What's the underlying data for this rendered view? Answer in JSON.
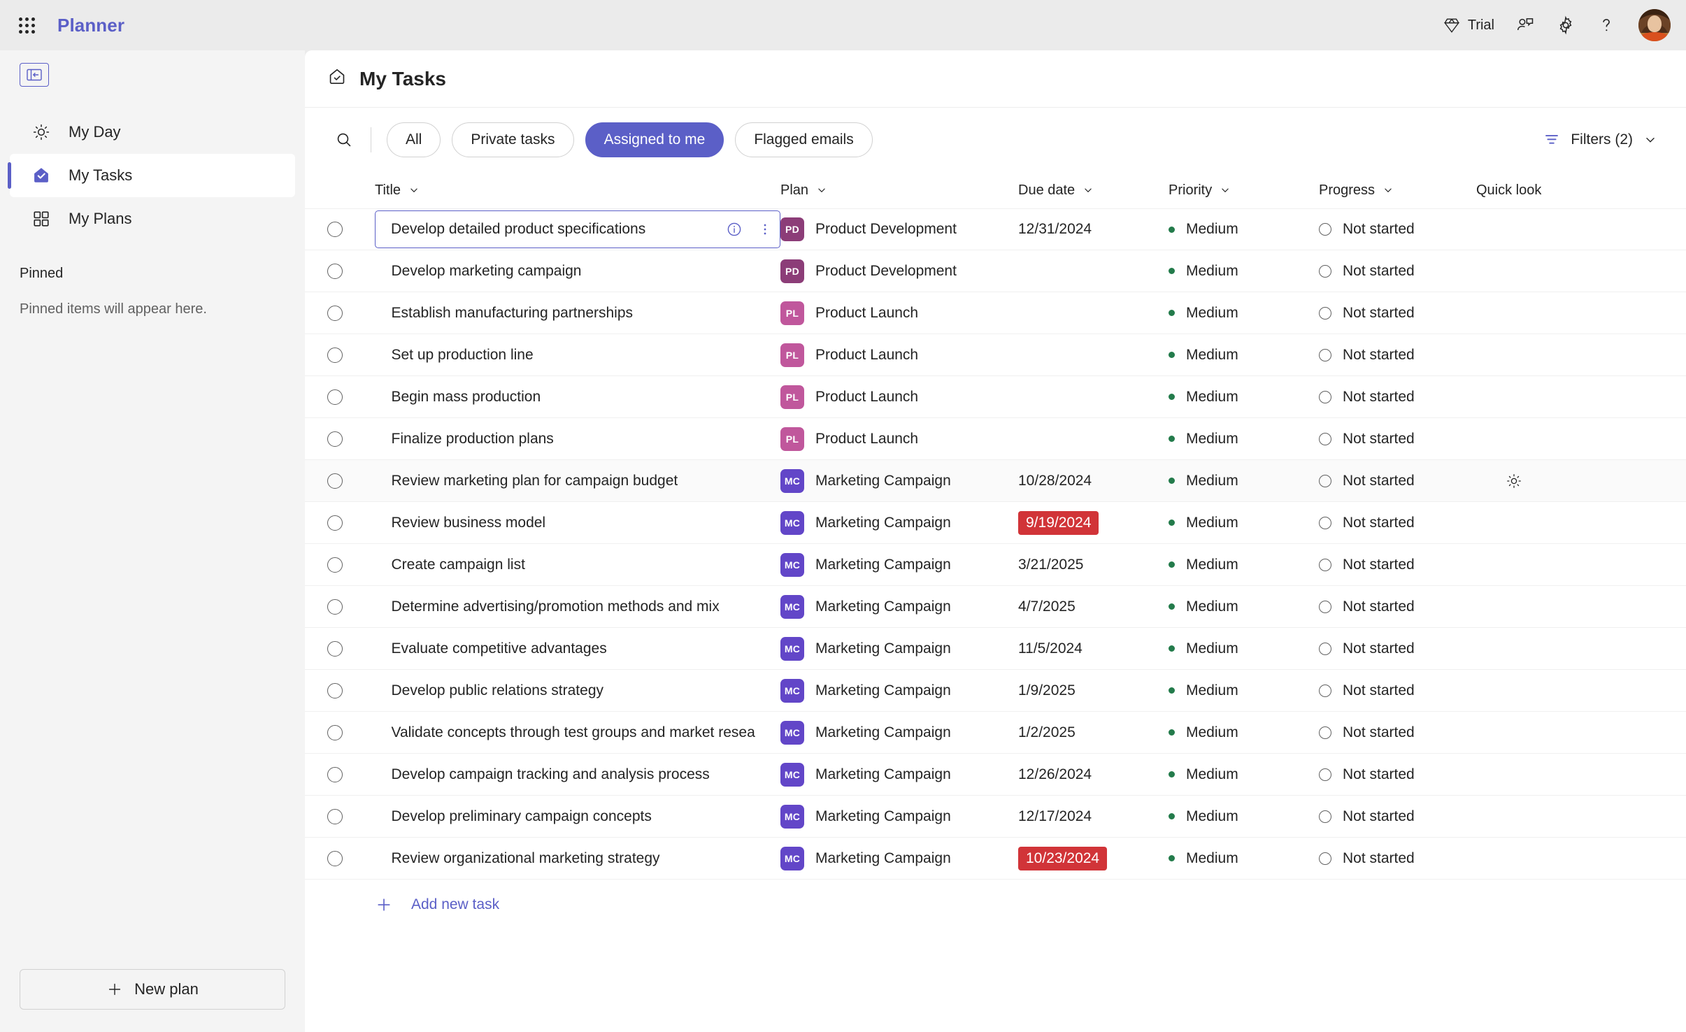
{
  "topbar": {
    "waffle_label": "app-launcher",
    "brand": "Planner",
    "trial_label": "Trial",
    "feedback_label": "feedback",
    "settings_label": "settings",
    "help_label": "help"
  },
  "sidebar": {
    "collapse_label": "collapse-navigation",
    "items": [
      {
        "label": "My Day",
        "icon": "sun-icon",
        "active": false
      },
      {
        "label": "My Tasks",
        "icon": "tasks-envelope-icon",
        "active": true
      },
      {
        "label": "My Plans",
        "icon": "grid-icon",
        "active": false
      }
    ],
    "pinned_header": "Pinned",
    "pinned_empty": "Pinned items will appear here.",
    "new_plan_label": "New plan"
  },
  "main": {
    "page_title": "My Tasks",
    "page_icon": "tasks-envelope-outline-icon",
    "search_placeholder": "Search",
    "pills": [
      {
        "label": "All",
        "selected": false
      },
      {
        "label": "Private tasks",
        "selected": false
      },
      {
        "label": "Assigned to me",
        "selected": true
      },
      {
        "label": "Flagged emails",
        "selected": false
      }
    ],
    "filters_label": "Filters (2)",
    "columns": [
      {
        "label": "Title",
        "sortable": true
      },
      {
        "label": "Plan",
        "sortable": true
      },
      {
        "label": "Due date",
        "sortable": true
      },
      {
        "label": "Priority",
        "sortable": true
      },
      {
        "label": "Progress",
        "sortable": true
      },
      {
        "label": "Quick look",
        "sortable": false
      }
    ],
    "add_new_task_label": "Add new task"
  },
  "colors": {
    "brand_purple": "#5b5fc7",
    "overdue_red": "#d13438",
    "priority_medium_green": "#237b4b",
    "plan_pd": "#8c3d78",
    "plan_pl": "#c0579c",
    "plan_mc": "#6246c8"
  },
  "plans": {
    "PD": {
      "initials": "PD",
      "name": "Product Development",
      "color": "#8c3d78"
    },
    "PL": {
      "initials": "PL",
      "name": "Product Launch",
      "color": "#c0579c"
    },
    "MC": {
      "initials": "MC",
      "name": "Marketing Campaign",
      "color": "#6246c8"
    }
  },
  "tasks": [
    {
      "title": "Develop detailed product specifications",
      "plan": "PD",
      "due": "12/31/2024",
      "overdue": false,
      "priority": "Medium",
      "progress": "Not started",
      "focused": true,
      "hovered": false
    },
    {
      "title": "Develop marketing campaign",
      "plan": "PD",
      "due": "",
      "overdue": false,
      "priority": "Medium",
      "progress": "Not started",
      "focused": false,
      "hovered": false
    },
    {
      "title": "Establish manufacturing partnerships",
      "plan": "PL",
      "due": "",
      "overdue": false,
      "priority": "Medium",
      "progress": "Not started",
      "focused": false,
      "hovered": false
    },
    {
      "title": "Set up production line",
      "plan": "PL",
      "due": "",
      "overdue": false,
      "priority": "Medium",
      "progress": "Not started",
      "focused": false,
      "hovered": false
    },
    {
      "title": "Begin mass production",
      "plan": "PL",
      "due": "",
      "overdue": false,
      "priority": "Medium",
      "progress": "Not started",
      "focused": false,
      "hovered": false
    },
    {
      "title": "Finalize production plans",
      "plan": "PL",
      "due": "",
      "overdue": false,
      "priority": "Medium",
      "progress": "Not started",
      "focused": false,
      "hovered": false
    },
    {
      "title": "Review marketing plan for campaign budget",
      "plan": "MC",
      "due": "10/28/2024",
      "overdue": false,
      "priority": "Medium",
      "progress": "Not started",
      "focused": false,
      "hovered": true
    },
    {
      "title": "Review business model",
      "plan": "MC",
      "due": "9/19/2024",
      "overdue": true,
      "priority": "Medium",
      "progress": "Not started",
      "focused": false,
      "hovered": false
    },
    {
      "title": "Create campaign list",
      "plan": "MC",
      "due": "3/21/2025",
      "overdue": false,
      "priority": "Medium",
      "progress": "Not started",
      "focused": false,
      "hovered": false
    },
    {
      "title": "Determine advertising/promotion methods and mix",
      "plan": "MC",
      "due": "4/7/2025",
      "overdue": false,
      "priority": "Medium",
      "progress": "Not started",
      "focused": false,
      "hovered": false
    },
    {
      "title": "Evaluate competitive advantages",
      "plan": "MC",
      "due": "11/5/2024",
      "overdue": false,
      "priority": "Medium",
      "progress": "Not started",
      "focused": false,
      "hovered": false
    },
    {
      "title": "Develop public relations strategy",
      "plan": "MC",
      "due": "1/9/2025",
      "overdue": false,
      "priority": "Medium",
      "progress": "Not started",
      "focused": false,
      "hovered": false
    },
    {
      "title": "Validate concepts through test groups and market resea",
      "plan": "MC",
      "due": "1/2/2025",
      "overdue": false,
      "priority": "Medium",
      "progress": "Not started",
      "focused": false,
      "hovered": false
    },
    {
      "title": "Develop campaign tracking and analysis process",
      "plan": "MC",
      "due": "12/26/2024",
      "overdue": false,
      "priority": "Medium",
      "progress": "Not started",
      "focused": false,
      "hovered": false
    },
    {
      "title": "Develop preliminary campaign concepts",
      "plan": "MC",
      "due": "12/17/2024",
      "overdue": false,
      "priority": "Medium",
      "progress": "Not started",
      "focused": false,
      "hovered": false
    },
    {
      "title": "Review organizational marketing strategy",
      "plan": "MC",
      "due": "10/23/2024",
      "overdue": true,
      "priority": "Medium",
      "progress": "Not started",
      "focused": false,
      "hovered": false
    }
  ]
}
